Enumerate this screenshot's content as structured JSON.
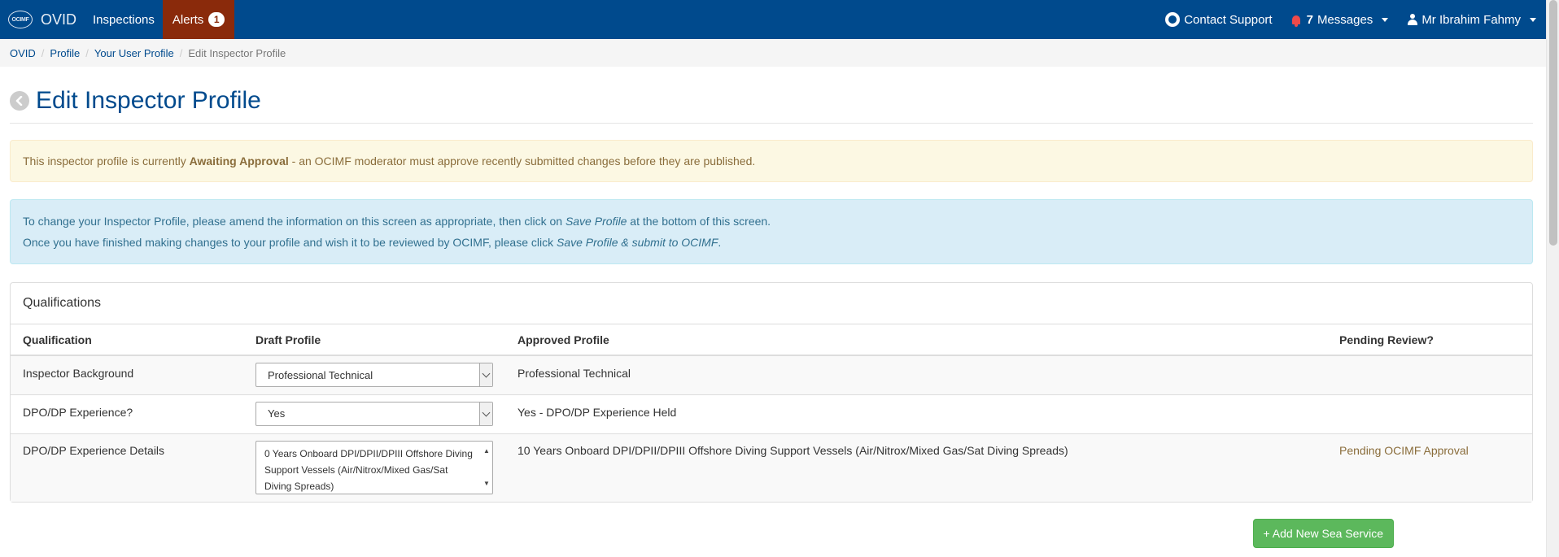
{
  "navbar": {
    "logo_text": "OCIMF",
    "brand": "OVID",
    "inspections_label": "Inspections",
    "alerts_label": "Alerts",
    "alerts_count": "1",
    "contact_support_label": "Contact Support",
    "messages_count": "7",
    "messages_label": "Messages",
    "user_name": "Mr Ibrahim Fahmy",
    "bar_color": "#004a8d",
    "alerts_color": "#8a2a0b"
  },
  "breadcrumb": [
    "OVID",
    "Profile",
    "Your User Profile",
    "Edit Inspector Profile"
  ],
  "page": {
    "title": "Edit Inspector Profile"
  },
  "status_alert": {
    "prefix": "This inspector profile is currently ",
    "status": "Awaiting Approval",
    "suffix": " - an OCIMF moderator must approve recently submitted changes before they are published."
  },
  "info_alert": {
    "line1_before": "To change your Inspector Profile, please amend the information on this screen as appropriate, then click on ",
    "line1_em": "Save Profile",
    "line1_after": " at the bottom of this screen.",
    "line2_before": "Once you have finished making changes to your profile and wish it to be reviewed by OCIMF, please click ",
    "line2_em": "Save Profile & submit to OCIMF",
    "line2_after": "."
  },
  "qualifications": {
    "heading": "Qualifications",
    "columns": [
      "Qualification",
      "Draft Profile",
      "Approved Profile",
      "Pending Review?"
    ],
    "rows": [
      {
        "label": "Inspector Background",
        "draft_value": "Professional Technical",
        "approved": "Professional Technical",
        "pending": ""
      },
      {
        "label": "DPO/DP Experience?",
        "draft_value": "Yes",
        "approved": "Yes - DPO/DP Experience Held",
        "pending": ""
      },
      {
        "label": "DPO/DP Experience Details",
        "draft_value": "0 Years Onboard DPI/DPII/DPIII Offshore Diving Support Vessels (Air/Nitrox/Mixed Gas/Sat Diving Spreads)",
        "approved": "10 Years Onboard DPI/DPII/DPIII Offshore Diving Support Vessels (Air/Nitrox/Mixed Gas/Sat Diving Spreads)",
        "pending": "Pending OCIMF Approval"
      }
    ]
  },
  "actions": {
    "add_sea_service_label": "+ Add New Sea Service"
  }
}
